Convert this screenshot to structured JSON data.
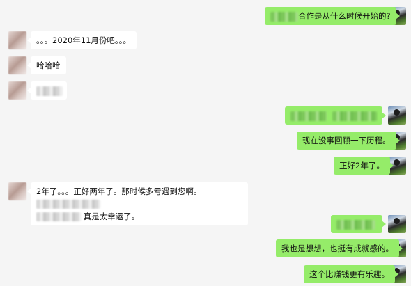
{
  "messages": [
    {
      "id": "m1",
      "side": "self",
      "text": "合作是从什么时候开始的?",
      "redacted_prefix": true
    },
    {
      "id": "m2",
      "side": "other",
      "text": "。。。2020年11月份吧。。。"
    },
    {
      "id": "m3",
      "side": "other",
      "text": "哈哈哈"
    },
    {
      "id": "m4",
      "side": "other",
      "text": "",
      "redacted_only": true
    },
    {
      "id": "m5",
      "side": "self",
      "text": "",
      "redacted_only": true
    },
    {
      "id": "m6",
      "side": "self",
      "text": "现在没事回顾一下历程。"
    },
    {
      "id": "m7",
      "side": "self",
      "text": "正好2年了。"
    },
    {
      "id": "m8",
      "side": "other",
      "line1": "2年了。。。正好两年了。那时候多亏遇到您啊。",
      "line2": "真是太幸运了。",
      "redacted": true
    },
    {
      "id": "m9",
      "side": "self",
      "text": "",
      "redacted_only": true
    },
    {
      "id": "m10",
      "side": "self",
      "text": "我也是想想，也挺有成就感的。"
    },
    {
      "id": "m11",
      "side": "self",
      "text": "这个比赚钱更有乐趣。"
    }
  ]
}
